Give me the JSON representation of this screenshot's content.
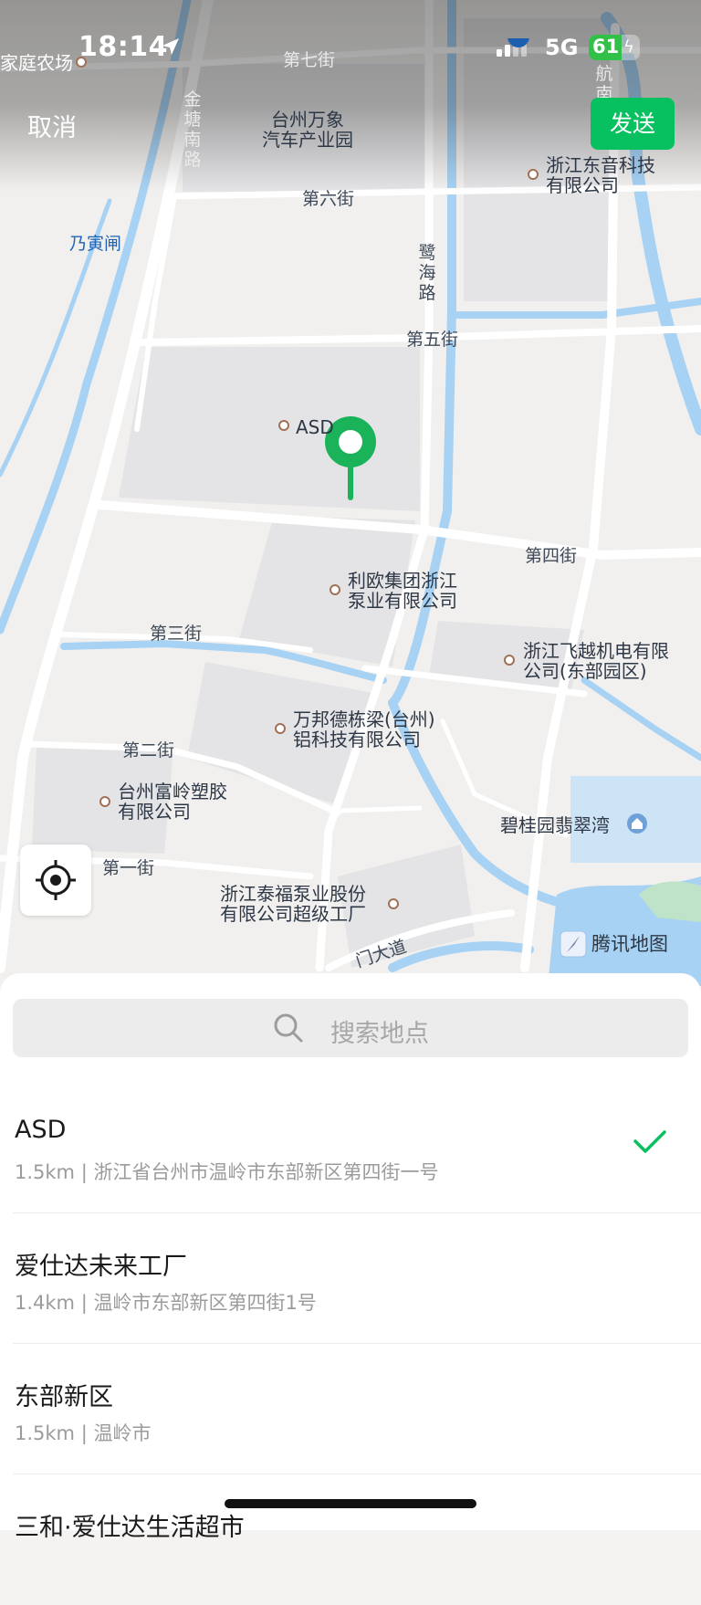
{
  "status_bar": {
    "time": "18:14",
    "network": "5G",
    "battery": "61"
  },
  "header": {
    "cancel_label": "取消",
    "send_label": "发送"
  },
  "map": {
    "labels": {
      "farm": "家庭农场",
      "street7": "第七街",
      "jintang_road": "金塘南路",
      "auto_park": "台州万象\n汽车产业园",
      "hang_nan": "航南",
      "dongyin": "浙江东音科技\n有限公司",
      "street6": "第六街",
      "naiyinzha": "乃寅闸",
      "luhai_road": "鹭海路",
      "street5": "第五街",
      "asd": "ASD",
      "street4": "第四街",
      "leo": "利欧集团浙江\n泵业有限公司",
      "street3": "第三街",
      "feiyue": "浙江飞越机电有限\n公司(东部园区)",
      "wanbang": "万邦德栋梁(台州)\n铝科技有限公司",
      "street2": "第二街",
      "fuling": "台州富岭塑胶\n有限公司",
      "biguiyuan": "碧桂园翡翠湾",
      "street1": "第一街",
      "taifu": "浙江泰福泵业股份\n有限公司超级工厂",
      "avenue": "门大道"
    },
    "brand": "腾讯地图"
  },
  "search": {
    "placeholder": "搜索地点"
  },
  "results": [
    {
      "name": "ASD",
      "address": "1.5km | 浙江省台州市温岭市东部新区第四街一号",
      "selected": true
    },
    {
      "name": "爱仕达未来工厂",
      "address": "1.4km | 温岭市东部新区第四街1号",
      "selected": false
    },
    {
      "name": "东部新区",
      "address": "1.5km | 温岭市",
      "selected": false
    },
    {
      "name": "三和·爱仕达生活超市",
      "address": "",
      "selected": false
    }
  ],
  "colors": {
    "accent": "#07c160",
    "water": "#9fcef3",
    "road": "#ffffff",
    "block": "#e3e3e5"
  }
}
